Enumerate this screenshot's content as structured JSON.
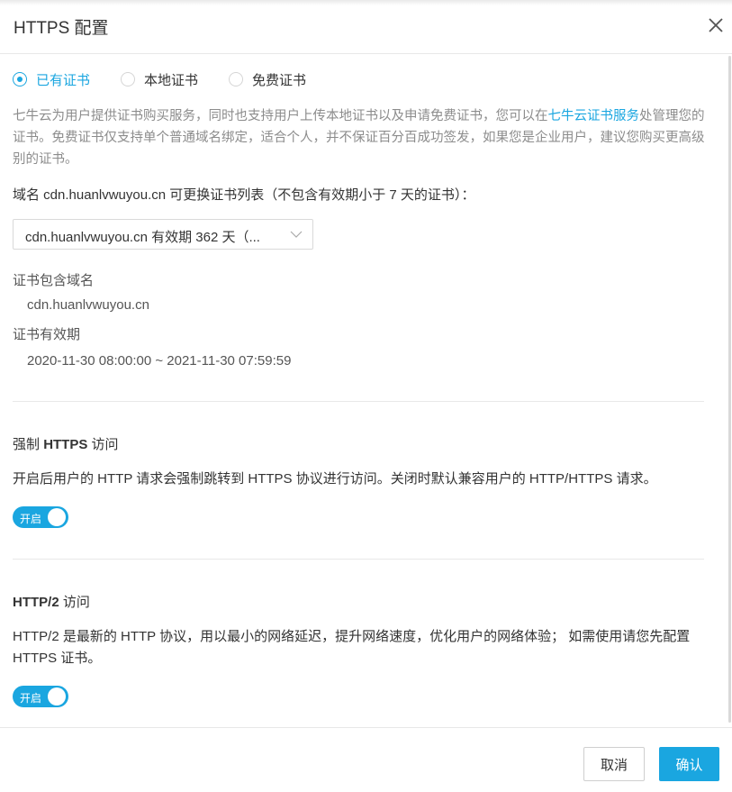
{
  "dialog": {
    "title": "HTTPS 配置"
  },
  "cert_source": {
    "options": [
      {
        "label": "已有证书",
        "checked": true
      },
      {
        "label": "本地证书",
        "checked": false
      },
      {
        "label": "免费证书",
        "checked": false
      }
    ]
  },
  "description": {
    "text_before": "七牛云为用户提供证书购买服务，同时也支持用户上传本地证书以及申请免费证书，您可以在",
    "link": "七牛云证书服务",
    "text_after": "处管理您的证书。免费证书仅支持单个普通域名绑定，适合个人，并不保证百分百成功签发，如果您是企业用户，建议您购买更高级别的证书。"
  },
  "domain": {
    "label": "域名 cdn.huanlvwuyou.cn 可更换证书列表（不包含有效期小于 7 天的证书）：",
    "selected": "cdn.huanlvwuyou.cn 有效期 362 天（..."
  },
  "cert_info": {
    "domains_label": "证书包含域名",
    "domains_value": "cdn.huanlvwuyou.cn",
    "validity_label": "证书有效期",
    "validity_value": "2020-11-30 08:00:00 ~ 2021-11-30 07:59:59"
  },
  "force_https": {
    "title_prefix": "强制",
    "title_bold": "HTTPS",
    "title_suffix": "访问",
    "desc": "开启后用户的 HTTP 请求会强制跳转到 HTTPS 协议进行访问。关闭时默认兼容用户的 HTTP/HTTPS 请求。",
    "toggle_label": "开启",
    "enabled": true
  },
  "http2": {
    "title_bold": "HTTP/2",
    "title_suffix": "访问",
    "desc": "HTTP/2 是最新的 HTTP 协议，用以最小的网络延迟，提升网络速度，优化用户的网络体验； 如需使用请您先配置 HTTPS 证书。",
    "toggle_label": "开启",
    "enabled": true
  },
  "footer": {
    "cancel_label": "取消",
    "ok_label": "确认"
  },
  "colors": {
    "accent": "#1aa6e0",
    "border": "#e8e8e8",
    "muted_text": "#8c8c8c"
  },
  "icons": {
    "close": "close-icon",
    "select_chevron": "chevron-down-icon"
  }
}
